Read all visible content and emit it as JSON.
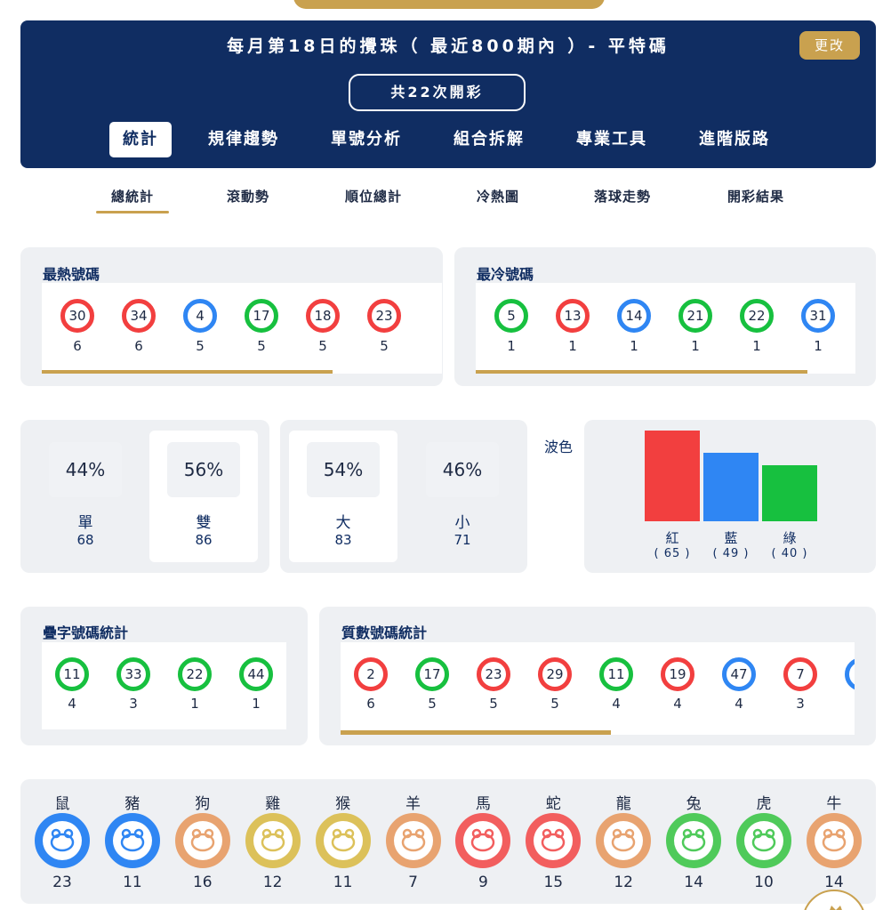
{
  "header": {
    "title": "每月第18日的攪珠（ 最近800期內 ）- 平特碼",
    "edit_label": "更改",
    "draw_count_label": "共22次開彩"
  },
  "main_tabs": [
    "統計",
    "規律趨勢",
    "單號分析",
    "組合拆解",
    "專業工具",
    "進階版路"
  ],
  "sub_tabs": [
    "總統計",
    "滾動勢",
    "順位總計",
    "冷熱圖",
    "落球走勢",
    "開彩結果"
  ],
  "hot": {
    "title": "最熱號碼",
    "balls": [
      {
        "num": "30",
        "count": "6",
        "color": "red"
      },
      {
        "num": "34",
        "count": "6",
        "color": "red"
      },
      {
        "num": "4",
        "count": "5",
        "color": "blue"
      },
      {
        "num": "17",
        "count": "5",
        "color": "green"
      },
      {
        "num": "18",
        "count": "5",
        "color": "red"
      },
      {
        "num": "23",
        "count": "5",
        "color": "red"
      }
    ]
  },
  "cold": {
    "title": "最冷號碼",
    "balls": [
      {
        "num": "5",
        "count": "1",
        "color": "green"
      },
      {
        "num": "13",
        "count": "1",
        "color": "red"
      },
      {
        "num": "14",
        "count": "1",
        "color": "blue"
      },
      {
        "num": "21",
        "count": "1",
        "color": "green"
      },
      {
        "num": "22",
        "count": "1",
        "color": "green"
      },
      {
        "num": "31",
        "count": "1",
        "color": "blue"
      }
    ]
  },
  "odd_even": [
    {
      "pct": "44%",
      "label": "單",
      "count": "68"
    },
    {
      "pct": "56%",
      "label": "雙",
      "count": "86"
    }
  ],
  "big_small": [
    {
      "pct": "54%",
      "label": "大",
      "count": "83"
    },
    {
      "pct": "46%",
      "label": "小",
      "count": "71"
    }
  ],
  "wave": {
    "title": "波色",
    "items": [
      {
        "label": "紅",
        "count": "( 65 )",
        "value": 65,
        "color": "#f23f3f"
      },
      {
        "label": "藍",
        "count": "( 49 )",
        "value": 49,
        "color": "#2f86f3"
      },
      {
        "label": "綠",
        "count": "( 40 )",
        "value": 40,
        "color": "#17c03f"
      }
    ]
  },
  "repeat": {
    "title": "疊字號碼統計",
    "balls": [
      {
        "num": "11",
        "count": "4",
        "color": "green"
      },
      {
        "num": "33",
        "count": "3",
        "color": "green"
      },
      {
        "num": "22",
        "count": "1",
        "color": "green"
      },
      {
        "num": "44",
        "count": "1",
        "color": "green"
      }
    ]
  },
  "prime": {
    "title": "質數號碼統計",
    "balls": [
      {
        "num": "2",
        "count": "6",
        "color": "red"
      },
      {
        "num": "17",
        "count": "5",
        "color": "green"
      },
      {
        "num": "23",
        "count": "5",
        "color": "red"
      },
      {
        "num": "29",
        "count": "5",
        "color": "red"
      },
      {
        "num": "11",
        "count": "4",
        "color": "green"
      },
      {
        "num": "19",
        "count": "4",
        "color": "red"
      },
      {
        "num": "47",
        "count": "4",
        "color": "blue"
      },
      {
        "num": "7",
        "count": "3",
        "color": "red"
      },
      {
        "num": "",
        "count": "",
        "color": "blue"
      }
    ]
  },
  "zodiac": [
    {
      "name": "鼠",
      "count": "23",
      "color": "blue",
      "icon": "rat-icon"
    },
    {
      "name": "豬",
      "count": "11",
      "color": "blue",
      "icon": "pig-icon"
    },
    {
      "name": "狗",
      "count": "16",
      "color": "orange",
      "icon": "dog-icon"
    },
    {
      "name": "雞",
      "count": "12",
      "color": "gold",
      "icon": "rooster-icon"
    },
    {
      "name": "猴",
      "count": "11",
      "color": "gold",
      "icon": "monkey-icon"
    },
    {
      "name": "羊",
      "count": "7",
      "color": "orange",
      "icon": "goat-icon"
    },
    {
      "name": "馬",
      "count": "9",
      "color": "red",
      "icon": "horse-icon"
    },
    {
      "name": "蛇",
      "count": "15",
      "color": "red",
      "icon": "snake-icon"
    },
    {
      "name": "龍",
      "count": "12",
      "color": "orange",
      "icon": "dragon-icon"
    },
    {
      "name": "兔",
      "count": "14",
      "color": "green",
      "icon": "rabbit-icon"
    },
    {
      "name": "虎",
      "count": "10",
      "color": "green",
      "icon": "tiger-icon"
    },
    {
      "name": "牛",
      "count": "14",
      "color": "orange",
      "icon": "ox-icon"
    }
  ],
  "colors": {
    "navy": "#102d62",
    "gold": "#c9a14f",
    "red": "#f23f3f",
    "blue": "#2f86f3",
    "green": "#17c03f",
    "orange": "#e8a370",
    "zodiac_gold": "#dcc15a"
  }
}
